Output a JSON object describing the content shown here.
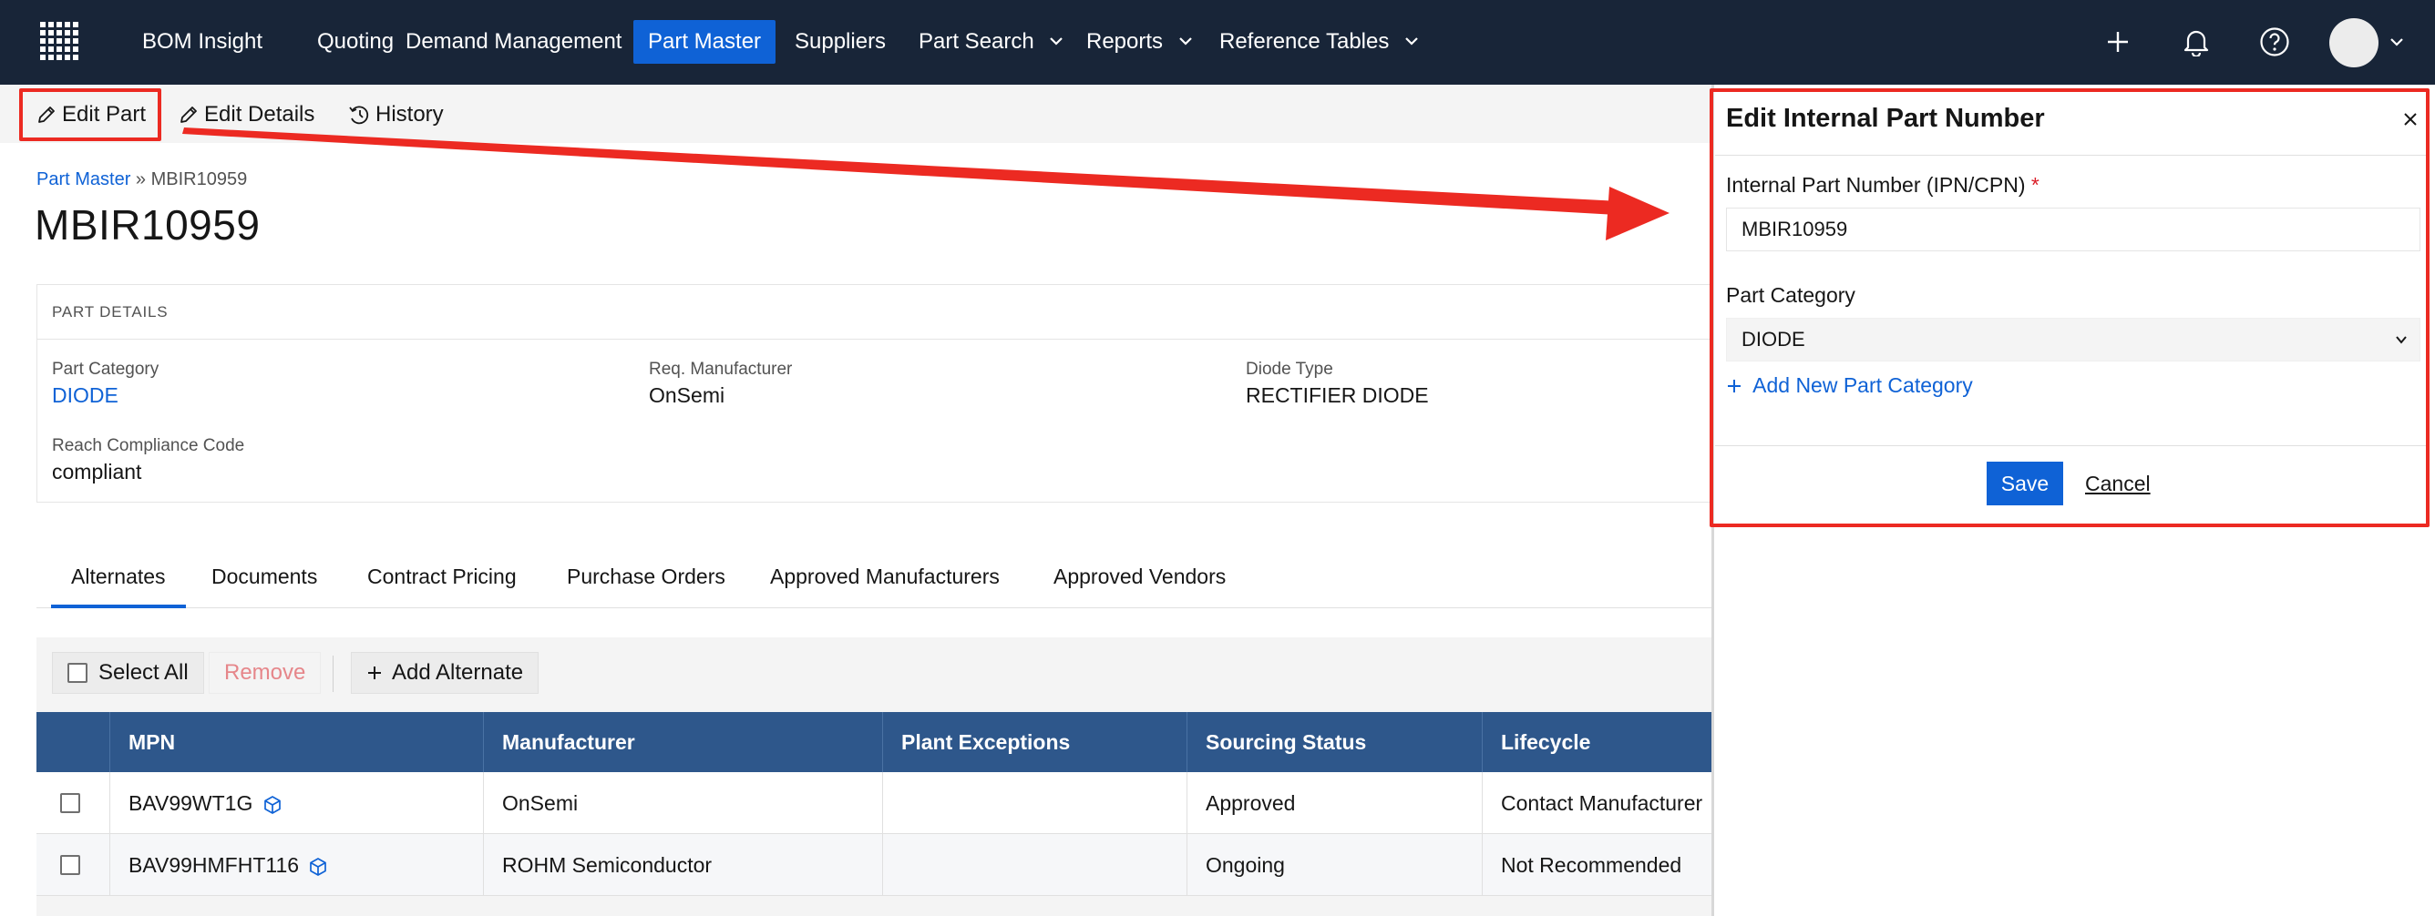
{
  "nav": {
    "items": [
      {
        "label": "BOM Insight"
      },
      {
        "label": "Quoting"
      },
      {
        "label": "Demand Management"
      },
      {
        "label": "Part Master"
      },
      {
        "label": "Suppliers"
      },
      {
        "label": "Part Search"
      },
      {
        "label": "Reports"
      },
      {
        "label": "Reference Tables"
      }
    ],
    "active": "Part Master",
    "icons": [
      "grid-logo-icon",
      "plus-icon",
      "bell-icon",
      "help-icon",
      "avatar"
    ]
  },
  "toolbar": {
    "edit_part": "Edit Part",
    "edit_details": "Edit Details",
    "history": "History"
  },
  "breadcrumb": {
    "parent": "Part Master",
    "separator": "»",
    "current": "MBIR10959"
  },
  "page": {
    "title": "MBIR10959"
  },
  "part_details": {
    "heading": "PART DETAILS",
    "fields": [
      {
        "label": "Part Category",
        "value": "DIODE"
      },
      {
        "label": "Req. Manufacturer",
        "value": "OnSemi"
      },
      {
        "label": "Diode Type",
        "value": "RECTIFIER DIODE"
      },
      {
        "label": "Reach Compliance Code",
        "value": "compliant"
      }
    ]
  },
  "tabs": [
    {
      "label": "Alternates"
    },
    {
      "label": "Documents"
    },
    {
      "label": "Contract Pricing"
    },
    {
      "label": "Purchase Orders"
    },
    {
      "label": "Approved Manufacturers"
    },
    {
      "label": "Approved Vendors"
    }
  ],
  "active_tab": "Alternates",
  "alternates": {
    "select_all": "Select All",
    "remove": "Remove",
    "add_alternate": "Add Alternate",
    "columns": [
      "MPN",
      "Manufacturer",
      "Plant Exceptions",
      "Sourcing Status",
      "Lifecycle"
    ],
    "rows": [
      {
        "mpn": "BAV99WT1G",
        "manufacturer": "OnSemi",
        "plant_exceptions": "",
        "sourcing_status": "Approved",
        "lifecycle": "Contact Manufacturer"
      },
      {
        "mpn": "BAV99HMFHT116",
        "manufacturer": "ROHM Semiconductor",
        "plant_exceptions": "",
        "sourcing_status": "Ongoing",
        "lifecycle": "Not Recommended"
      }
    ]
  },
  "side_panel": {
    "title": "Edit Internal Part Number",
    "ipn_label": "Internal Part Number (IPN/CPN)",
    "required_mark": "*",
    "ipn_value": "MBIR10959",
    "category_label": "Part Category",
    "category_value": "DIODE",
    "add_category": "Add New Part Category",
    "save": "Save",
    "cancel": "Cancel"
  },
  "colors": {
    "nav_bg": "#182538",
    "accent": "#0f62d6",
    "grid_header": "#2e578b",
    "annotation": "#ec2a22"
  }
}
